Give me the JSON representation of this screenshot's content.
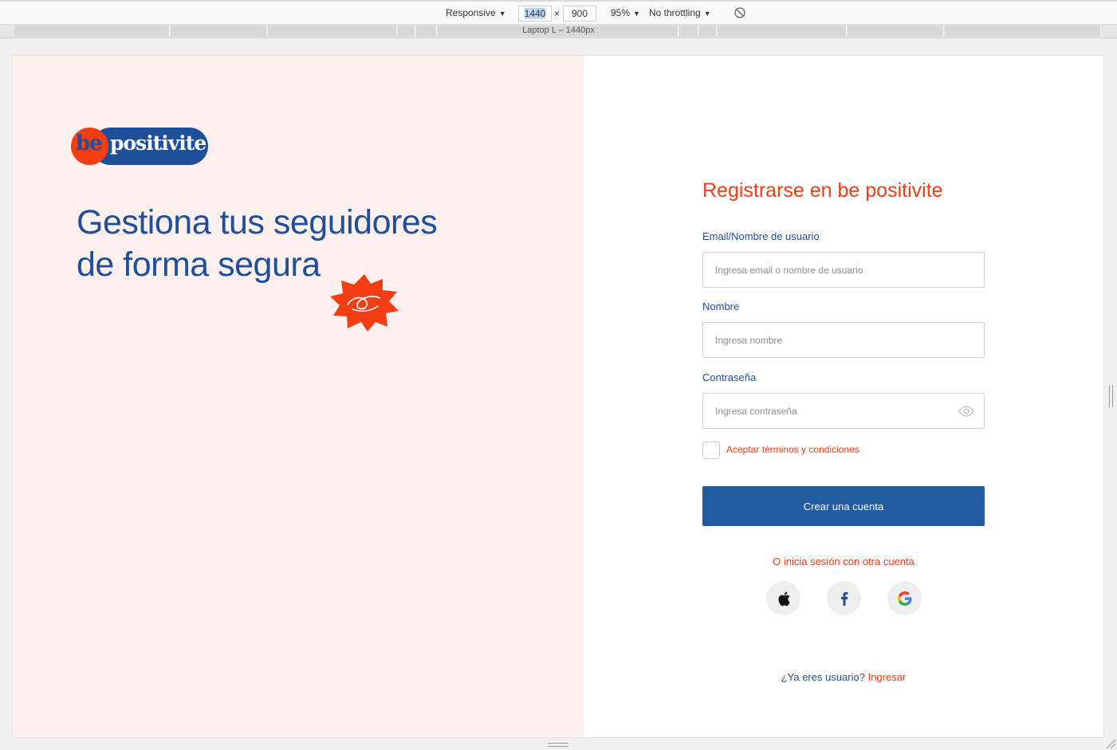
{
  "devtools": {
    "device": "Responsive",
    "width": "1440",
    "height": "900",
    "times": "×",
    "zoom": "95%",
    "throttling": "No throttling",
    "media_label": "Laptop L – 1440px"
  },
  "brand": {
    "logo_be": "be",
    "logo_name": "positivite",
    "primary_color": "#1f4f99",
    "accent_color": "#f33d12",
    "left_bg": "#fdf0ee"
  },
  "hero": {
    "line1": "Gestiona tus seguidores",
    "line2": "de forma segura"
  },
  "form": {
    "title": "Registrarse en be positivite",
    "email_label": "Email/Nombre de usuario",
    "email_placeholder": "Ingresa email o nombre de usuario",
    "name_label": "Nombre",
    "name_placeholder": "Ingresa nombre",
    "password_label": "Contraseña",
    "password_placeholder": "Ingresa contraseña",
    "terms_label": "Aceptar términos y condiciones",
    "terms_checked": false,
    "submit_label": "Crear una cuenta",
    "alt_login_text": "O inicia sesión con otra cuenta",
    "social": [
      "apple-icon",
      "facebook-icon",
      "google-icon"
    ],
    "existing_user_text": "¿Ya eres usuario?",
    "login_link": "Ingresar"
  }
}
